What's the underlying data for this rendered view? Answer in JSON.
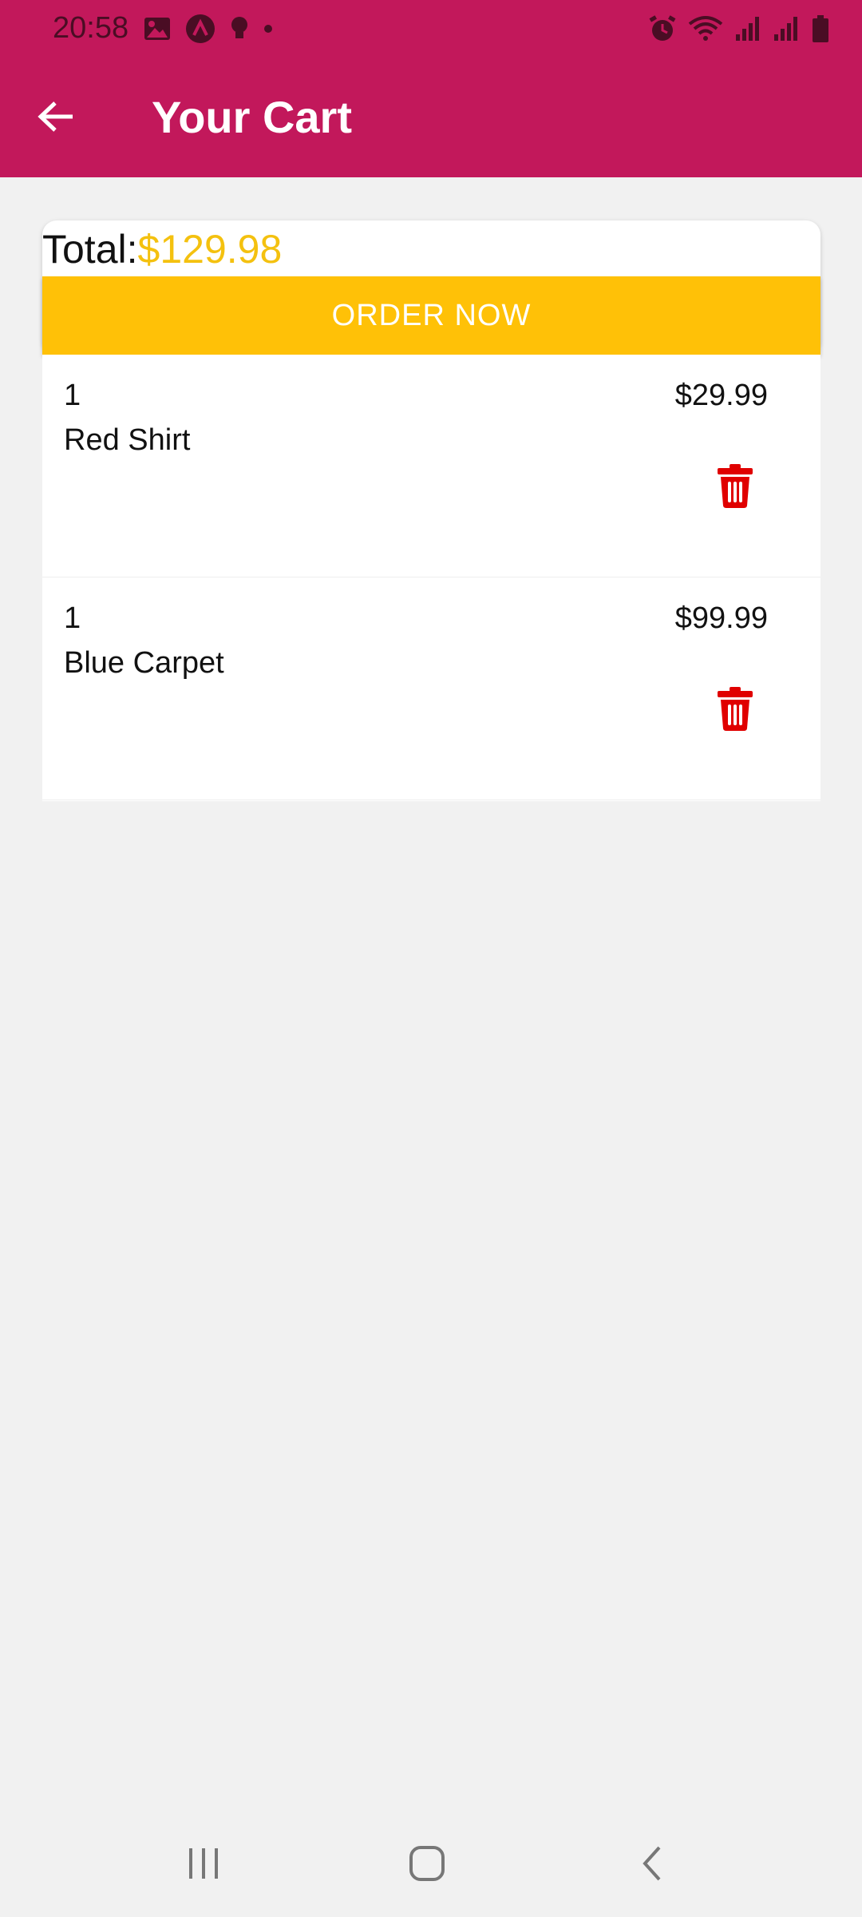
{
  "status_bar": {
    "time": "20:58",
    "left_icons": [
      "image-icon",
      "app-a-icon",
      "bulb-icon",
      "dot-icon"
    ],
    "right_icons": [
      "alarm-icon",
      "wifi-icon",
      "signal-icon",
      "signal-icon",
      "battery-icon"
    ]
  },
  "app_bar": {
    "title": "Your Cart",
    "back_icon": "arrow-left-icon"
  },
  "summary": {
    "total_label": "Total:",
    "total_amount": "$129.98",
    "order_button_label": "ORDER NOW"
  },
  "cart_items": [
    {
      "quantity": "1",
      "name": "Red Shirt",
      "price": "$29.99",
      "delete_icon": "trash-icon"
    },
    {
      "quantity": "1",
      "name": "Blue Carpet",
      "price": "$99.99",
      "delete_icon": "trash-icon"
    }
  ],
  "nav_bar": {
    "items": [
      "recent-apps-icon",
      "home-icon",
      "back-icon"
    ]
  },
  "colors": {
    "primary": "#c2185b",
    "accent": "#ffc107",
    "total_amount": "#f4c10f",
    "delete": "#e00000",
    "background": "#f1f1f1"
  }
}
